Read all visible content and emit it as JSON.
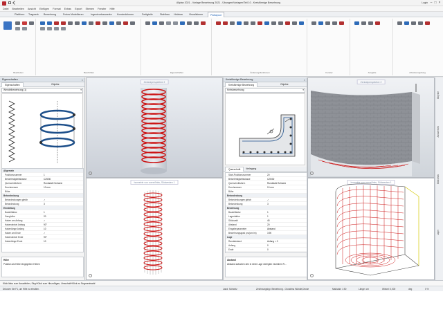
{
  "window": {
    "title": "Allplan 2021 - Vorlage Bewehrung 2021 - Übungen\\Vorlagen\\Teil 10 - Kreisförmige Bewehrung",
    "user_label": "Login",
    "controls": [
      "–",
      "□",
      "×"
    ]
  },
  "menu": [
    "Datei",
    "Bearbeiten",
    "Ansicht",
    "Einfügen",
    "Format",
    "Extras",
    "Export",
    "Ebenen",
    "Fenster",
    "Hilfe"
  ],
  "ribbon_tabs": [
    "Plattform",
    "Tragwerk",
    "Bewehrung",
    "Freies Modellieren",
    "Ingenieurbauwerke",
    "Konstruktionen",
    "Fertigteile",
    "Stahlbau",
    "Holzbau",
    "Visualisieren",
    "Plotlayout"
  ],
  "ribbon_active_tab": "Plotlayout",
  "ribbon_groups": [
    "Bearbeiten",
    "Beschriften",
    "Eigenschaften",
    "Änderungsfunktionen",
    "Fenster",
    "Ausgabe",
    "Arbeitsumgebung"
  ],
  "left_panel": {
    "title": "Eigenschaften",
    "tabs": [
      "Eigenschaften",
      "Objekte"
    ],
    "combo": "Wendelbewehrung (1)",
    "sections": [
      {
        "title": "Allgemein",
        "rows": [
          {
            "k": "Positionsnummer",
            "v": "1"
          },
          {
            "k": "Betonfestigkeitsklasse",
            "v": "C25/30"
          },
          {
            "k": "Querschnittsform",
            "v": "Rundstahl Schweiz"
          },
          {
            "k": "Durchmesser",
            "v": "10 mm"
          },
          {
            "k": "Bühe",
            "v": ""
          }
        ]
      },
      {
        "title": "Betondeckung",
        "rows": [
          {
            "k": "Betondeckungen gleich",
            "v": "✓"
          },
          {
            "k": "Betondeckung",
            "v": "3"
          }
        ]
      },
      {
        "title": "Einstellung",
        "rows": [
          {
            "k": "Bauteilfaktor",
            "v": "1"
          },
          {
            "k": "Ganghöhe",
            "v": "20"
          },
          {
            "k": "Haken am Anfang",
            "v": "✓"
          },
          {
            "k": "Hakenwinkel Anfang",
            "v": "90°"
          },
          {
            "k": "Hakenlänge Anfang",
            "v": "10"
          },
          {
            "k": "Haken am Ende",
            "v": "✓"
          },
          {
            "k": "Hakenwinkel Ende",
            "v": "90°"
          },
          {
            "k": "Hakenlänge Ende",
            "v": "10"
          }
        ]
      }
    ],
    "help_title": "Höhe",
    "help_text": "Position als Höhe eingegeben Höhen"
  },
  "mid_panel": {
    "title": "Kreisförmige Bewehrung",
    "tabs": [
      "Kreisförmige Bewehrung",
      "Objekte"
    ],
    "combo": "Kreisbewehrung",
    "subtabs": [
      "Querschnitt",
      "Verlegung"
    ],
    "sections": [
      {
        "title": "",
        "rows": [
          {
            "k": "Start-Positionsnummer",
            "v": "20"
          },
          {
            "k": "Betonfestigkeitsklasse",
            "v": "C25/30"
          },
          {
            "k": "Querschnittsform",
            "v": "Rundstahl Schweiz"
          },
          {
            "k": "Durchmesser",
            "v": "10 mm"
          },
          {
            "k": "Bühe",
            "v": ""
          }
        ]
      },
      {
        "title": "Betondeckung",
        "rows": [
          {
            "k": "Betondeckungen gleich",
            "v": "✓"
          },
          {
            "k": "Betondeckung",
            "v": "3"
          }
        ]
      },
      {
        "title": "Bewehrung",
        "rows": [
          {
            "k": "Bauteilfaktor",
            "v": "1"
          },
          {
            "k": "Lagenfaktor",
            "v": "1"
          },
          {
            "k": "Stückzahl",
            "v": "45"
          },
          {
            "k": "Abstand",
            "v": "20"
          },
          {
            "k": "Eingabeparameter",
            "v": "Abstand"
          },
          {
            "k": "Bewehrungsgrad pro(cm²/m)",
            "v": "3.90"
          }
        ]
      },
      {
        "title": "Lage",
        "rows": [
          {
            "k": "Randabstand",
            "v": "Anfang = 0"
          },
          {
            "k": "Anfang",
            "v": "0"
          },
          {
            "k": "Ende",
            "v": "0"
          }
        ]
      }
    ],
    "help_title": "Abstand",
    "help_text": "Abstand zwischen den in einer Lage verlegten einzelnen R..."
  },
  "views": {
    "tl_title": "Zentralperspektive 2",
    "bl_title": "Isometrie von vorne/links, Südwesten 1",
    "tr_title": "Zentralperspektive 2",
    "br_title": "Isometrie von vorne/links, Südwesten 1"
  },
  "sidebar_tabs": [
    "Objekte",
    "Assistenten",
    "Bibliothek",
    "Layer"
  ],
  "command_line": "Klick links zum Auswählen, Strg+Klick zum Hinzufügen, Umschalt+Klick zu Segmentwahl",
  "status": {
    "hint": "Drücken Sie F1, um Hilfe zu erhalten.",
    "land": "Land: Schweiz",
    "drawing": "Zeichnungstyp: Bewehrung - Grundriss Wände,Decke",
    "scale": "Maßstab: 1:50",
    "length": "Länge: cm",
    "angle": "Winkel: 0,000",
    "unit": "deg",
    "percent": "0 %"
  },
  "colors": {
    "rebar_red": "#cc1414",
    "helix_blue": "#1d4f8a",
    "accent": "#1a5fb4",
    "viewport_bg": "#e9edf2"
  }
}
